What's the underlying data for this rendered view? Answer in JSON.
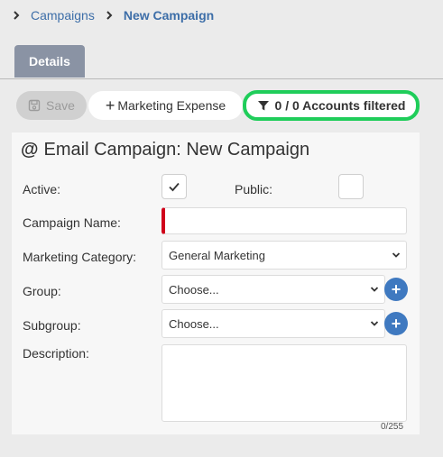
{
  "breadcrumb": {
    "root": "Campaigns",
    "current": "New Campaign"
  },
  "tabs": [
    {
      "label": "Details",
      "active": true
    }
  ],
  "toolbar": {
    "save_label": "Save",
    "expense_label": "Marketing Expense",
    "filter_label": "0 / 0 Accounts filtered"
  },
  "form": {
    "title_icon": "@",
    "title": "Email Campaign: New Campaign",
    "active_label": "Active:",
    "active_checked": true,
    "public_label": "Public:",
    "public_checked": false,
    "campaign_name_label": "Campaign Name:",
    "campaign_name_value": "",
    "marketing_category_label": "Marketing Category:",
    "marketing_category_value": "General Marketing",
    "group_label": "Group:",
    "group_value": "Choose...",
    "subgroup_label": "Subgroup:",
    "subgroup_value": "Choose...",
    "description_label": "Description:",
    "description_counter": "0/255"
  },
  "colors": {
    "link": "#3d6ea8",
    "tab_active": "#8a93a4",
    "highlight_border": "#1fcd5a",
    "required_marker": "#d0021b",
    "plus_button": "#3f79c0"
  }
}
